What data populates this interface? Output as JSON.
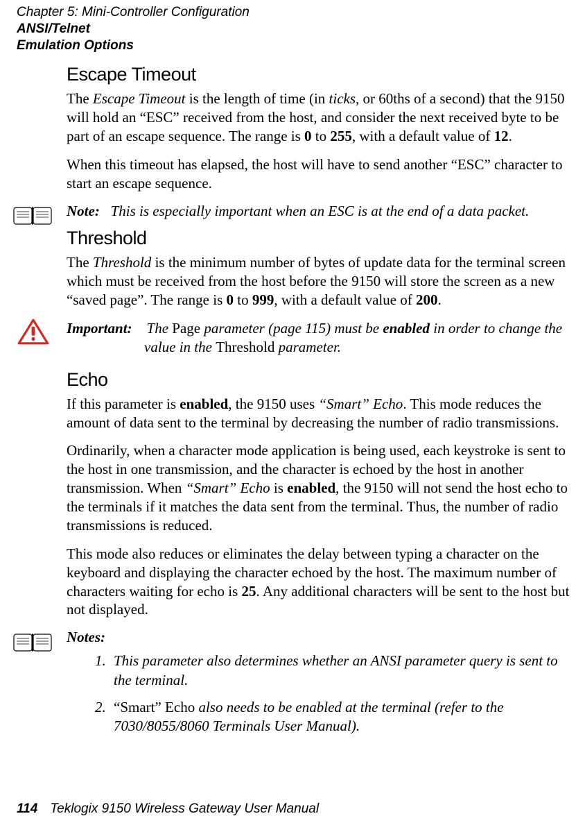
{
  "header": {
    "chapter": "Chapter 5:  Mini-Controller Configuration",
    "section_line1": "ANSI/Telnet",
    "section_line2": "Emulation Options"
  },
  "sections": {
    "escape": {
      "title": "Escape Timeout",
      "p1_a": "The ",
      "p1_b": "Escape Timeout",
      "p1_c": " is the length of time (in ",
      "p1_d": "ticks",
      "p1_e": ", or 60ths of a second) that the 9150 will hold an “ESC” received from the host, and consider the next received byte to be part of an escape sequence. The range is ",
      "p1_f": "0",
      "p1_g": " to ",
      "p1_h": "255",
      "p1_i": ", with a default value of ",
      "p1_j": "12",
      "p1_k": ".",
      "p2": "When this timeout has elapsed, the host will have to send another “ESC” character to start an escape sequence.",
      "note_label": "Note:",
      "note_text": "This is especially important when an ESC is at the end of a data packet."
    },
    "threshold": {
      "title": "Threshold",
      "p1_a": "The ",
      "p1_b": "Threshold",
      "p1_c": " is the minimum number of bytes of update data for the terminal screen which must be received from the host before the 9150 will store the screen as a new “saved page”. The range is ",
      "p1_d": "0",
      "p1_e": " to ",
      "p1_f": "999",
      "p1_g": ", with a default value of ",
      "p1_h": "200",
      "p1_i": ".",
      "important_label": "Important:",
      "imp_a": "The ",
      "imp_b": "Page",
      "imp_c": " parameter (page 115) must be ",
      "imp_d": "enabled",
      "imp_e": " in order to change the value in the ",
      "imp_f": "Threshold",
      "imp_g": " parameter."
    },
    "echo": {
      "title": "Echo",
      "p1_a": "If this parameter is ",
      "p1_b": "enabled",
      "p1_c": ", the 9150 uses ",
      "p1_d": "“Smart” Echo",
      "p1_e": ". This mode reduces the amount of data sent to the terminal by decreasing the number of radio transmissions.",
      "p2_a": "Ordinarily, when a character mode application is being used, each keystroke is sent to the host in one transmission, and the character is echoed by the host in another transmission. When ",
      "p2_b": "“Smart” Echo",
      "p2_c": " is ",
      "p2_d": "enabled",
      "p2_e": ", the 9150 will not send the host echo to the terminals if it matches the data sent from the terminal. Thus, the number of radio transmissions is reduced.",
      "p3_a": "This mode also reduces or eliminates the delay between typing a character on the keyboard and displaying the character echoed by the host. The maximum number of characters waiting for echo is ",
      "p3_b": "25",
      "p3_c": ". Any additional characters will be sent to the host but not displayed.",
      "notes_label": "Notes:",
      "note1": "This parameter also determines whether an ANSI parameter query is sent to the terminal.",
      "note2_a": "“Smart” Echo",
      "note2_b": " also needs to be enabled at the terminal (refer to the 7030/8055/8060 Terminals User Manual)."
    }
  },
  "footer": {
    "page": "114",
    "title": "Teklogix 9150 Wireless Gateway User Manual"
  }
}
